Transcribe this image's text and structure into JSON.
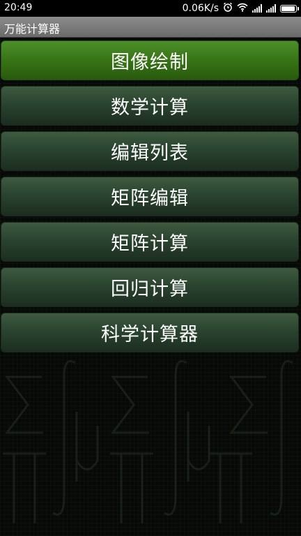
{
  "status_bar": {
    "time": "20:49",
    "speed": "0.06K/s"
  },
  "app": {
    "title": "万能计算器"
  },
  "menu": {
    "items": [
      {
        "label": "图像绘制",
        "active": true
      },
      {
        "label": "数学计算",
        "active": false
      },
      {
        "label": "编辑列表",
        "active": false
      },
      {
        "label": "矩阵编辑",
        "active": false
      },
      {
        "label": "矩阵计算",
        "active": false
      },
      {
        "label": "回归计算",
        "active": false
      },
      {
        "label": "科学计算器",
        "active": false
      }
    ]
  },
  "colors": {
    "active_button": "#3a7618",
    "button": "#2a4430",
    "title_bar": "#7a7a7a"
  },
  "icons": [
    "alarm-icon",
    "wifi-icon",
    "signal-icon",
    "battery-icon"
  ]
}
